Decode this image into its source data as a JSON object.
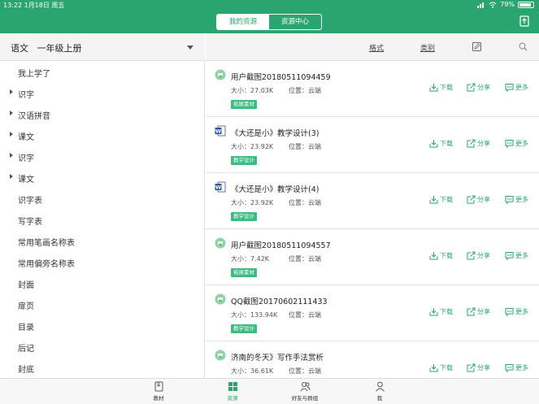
{
  "status_bar": {
    "time_date": "13:22   1月18日 周五",
    "battery": "79%"
  },
  "header": {
    "tabs": [
      {
        "label": "我的资源",
        "active": true
      },
      {
        "label": "资源中心",
        "active": false
      }
    ]
  },
  "left_panel": {
    "subject": "语文",
    "book": "一年级上册",
    "toc": [
      {
        "label": "我上学了",
        "expandable": false
      },
      {
        "label": "识字",
        "expandable": true
      },
      {
        "label": "汉语拼音",
        "expandable": true
      },
      {
        "label": "课文",
        "expandable": true
      },
      {
        "label": "识字",
        "expandable": true
      },
      {
        "label": "课文",
        "expandable": true
      },
      {
        "label": "识字表",
        "expandable": false
      },
      {
        "label": "写字表",
        "expandable": false
      },
      {
        "label": "常用笔画名称表",
        "expandable": false
      },
      {
        "label": "常用偏旁名称表",
        "expandable": false
      },
      {
        "label": "封面",
        "expandable": false
      },
      {
        "label": "扉页",
        "expandable": false
      },
      {
        "label": "目录",
        "expandable": false
      },
      {
        "label": "后记",
        "expandable": false
      },
      {
        "label": "封底",
        "expandable": false
      }
    ]
  },
  "right_panel": {
    "filters": {
      "format": "格式",
      "category": "类别"
    },
    "actions": {
      "download": "下载",
      "share": "分享",
      "more": "更多"
    },
    "files": [
      {
        "type": "image",
        "name": "用户截图20180511094459",
        "size": "大小：27.03K",
        "location": "位置：云端",
        "tag": "拓展素材"
      },
      {
        "type": "word",
        "name": "《大还是小》教学设计(3)",
        "size": "大小：23.92K",
        "location": "位置：云端",
        "tag": "教学设计"
      },
      {
        "type": "word",
        "name": "《大还是小》教学设计(4)",
        "size": "大小：23.92K",
        "location": "位置：云端",
        "tag": "教学设计"
      },
      {
        "type": "image",
        "name": "用户截图20180511094557",
        "size": "大小：7.42K",
        "location": "位置：云端",
        "tag": "拓展素材"
      },
      {
        "type": "image",
        "name": "QQ截图20170602111433",
        "size": "大小：133.94K",
        "location": "位置：云端",
        "tag": "教学设计"
      },
      {
        "type": "image",
        "name": "济南的冬天》写作手法赏析",
        "size": "大小：36.61K",
        "location": "位置：云端",
        "tag": ""
      }
    ]
  },
  "bottom_tabs": [
    {
      "label": "教材",
      "icon": "book-icon",
      "active": false
    },
    {
      "label": "资源",
      "icon": "grid-icon",
      "active": true
    },
    {
      "label": "好友与群组",
      "icon": "friends-icon",
      "active": false
    },
    {
      "label": "我",
      "icon": "person-icon",
      "active": false
    }
  ],
  "colors": {
    "brand_green": "#2aa56f",
    "tag_green": "#3dbb83",
    "word_blue": "#2b579a"
  }
}
